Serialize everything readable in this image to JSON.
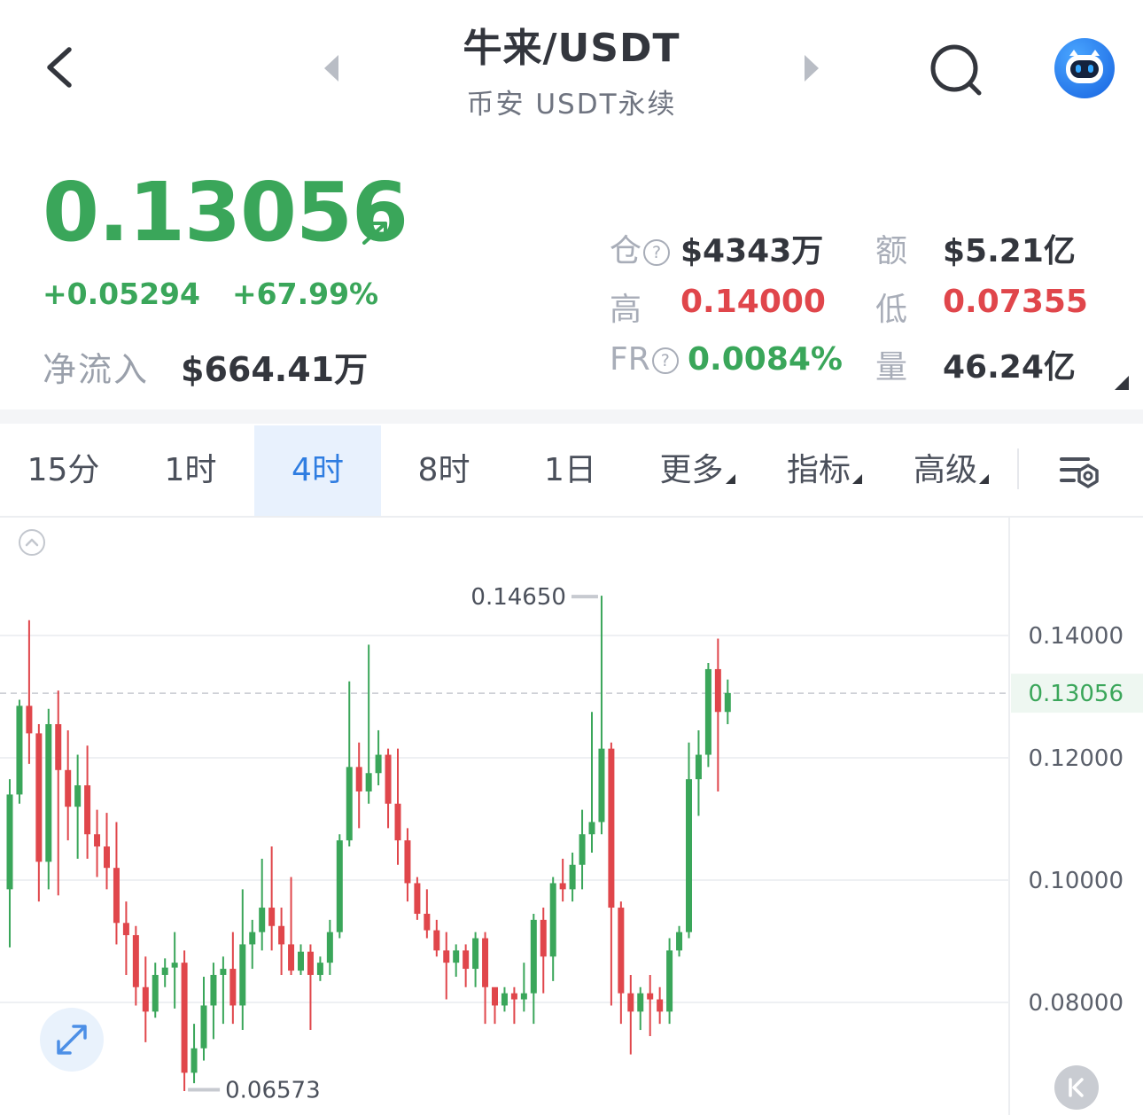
{
  "header": {
    "title": "牛来/USDT",
    "subtitle": "币安 USDT永续"
  },
  "price": {
    "last": "0.13056",
    "change": "+0.05294",
    "change_pct": "+67.99%",
    "inflow_label": "净流入",
    "inflow_value": "$664.41万"
  },
  "stats": {
    "oi_label": "仓",
    "oi_value": "$4343万",
    "turnover_label": "额",
    "turnover_value": "$5.21亿",
    "high_label": "高",
    "high_value": "0.14000",
    "low_label": "低",
    "low_value": "0.07355",
    "fr_label": "FR",
    "fr_value": "0.0084%",
    "volume_label": "量",
    "volume_value": "46.24亿",
    "help_glyph": "?"
  },
  "tabs": [
    {
      "label": "15分",
      "active": false
    },
    {
      "label": "1时",
      "active": false
    },
    {
      "label": "4时",
      "active": true
    },
    {
      "label": "8时",
      "active": false
    },
    {
      "label": "1日",
      "active": false
    },
    {
      "label": "更多",
      "active": false
    },
    {
      "label": "指标",
      "active": false
    },
    {
      "label": "高级",
      "active": false
    }
  ],
  "colors": {
    "up": "#3aa65a",
    "down": "#e0464b",
    "accent": "#2f7de1"
  },
  "chart_data": {
    "type": "candlestick",
    "y_ticks": [
      "0.14000",
      "0.12000",
      "0.10000",
      "0.08000"
    ],
    "y_tick_values": [
      0.14,
      0.12,
      0.1,
      0.08
    ],
    "last_price_label": "0.13056",
    "last_price": 0.13056,
    "max_label": "0.14650",
    "max_value": 0.1465,
    "min_label": "0.06573",
    "min_value": 0.06573,
    "ylim": [
      0.062,
      0.15
    ],
    "candles": [
      [
        0.0985,
        0.114,
        0.089,
        0.1165
      ],
      [
        0.114,
        0.1285,
        0.1125,
        0.1295
      ],
      [
        0.1285,
        0.124,
        0.119,
        0.1425
      ],
      [
        0.124,
        0.103,
        0.0965,
        0.1255
      ],
      [
        0.103,
        0.1255,
        0.0985,
        0.128
      ],
      [
        0.1255,
        0.118,
        0.0975,
        0.131
      ],
      [
        0.118,
        0.112,
        0.1065,
        0.1245
      ],
      [
        0.112,
        0.1155,
        0.1035,
        0.1205
      ],
      [
        0.1155,
        0.1075,
        0.1035,
        0.122
      ],
      [
        0.1075,
        0.1055,
        0.1005,
        0.1115
      ],
      [
        0.1055,
        0.102,
        0.0985,
        0.111
      ],
      [
        0.102,
        0.093,
        0.0895,
        0.1095
      ],
      [
        0.093,
        0.091,
        0.0845,
        0.0965
      ],
      [
        0.091,
        0.0825,
        0.0795,
        0.0925
      ],
      [
        0.0825,
        0.0785,
        0.0735,
        0.0875
      ],
      [
        0.0785,
        0.0845,
        0.0775,
        0.0865
      ],
      [
        0.0845,
        0.0857,
        0.0825,
        0.0872
      ],
      [
        0.0857,
        0.0865,
        0.079,
        0.0915
      ],
      [
        0.0865,
        0.0685,
        0.0655,
        0.0885
      ],
      [
        0.0685,
        0.0725,
        0.0668,
        0.0765
      ],
      [
        0.0725,
        0.0795,
        0.0705,
        0.0842
      ],
      [
        0.0795,
        0.0845,
        0.074,
        0.0865
      ],
      [
        0.0845,
        0.0855,
        0.0765,
        0.0875
      ],
      [
        0.0855,
        0.0795,
        0.0765,
        0.0915
      ],
      [
        0.0795,
        0.0895,
        0.0755,
        0.0985
      ],
      [
        0.0895,
        0.0915,
        0.0855,
        0.0935
      ],
      [
        0.0915,
        0.0955,
        0.0885,
        0.1035
      ],
      [
        0.0955,
        0.0925,
        0.0885,
        0.1055
      ],
      [
        0.0925,
        0.0895,
        0.0845,
        0.0955
      ],
      [
        0.0895,
        0.0852,
        0.0845,
        0.1005
      ],
      [
        0.0852,
        0.0883,
        0.0845,
        0.0895
      ],
      [
        0.0883,
        0.0845,
        0.0755,
        0.0895
      ],
      [
        0.0845,
        0.0865,
        0.0835,
        0.0875
      ],
      [
        0.0865,
        0.0915,
        0.0845,
        0.0935
      ],
      [
        0.0915,
        0.1065,
        0.0905,
        0.1075
      ],
      [
        0.1065,
        0.1185,
        0.1055,
        0.1325
      ],
      [
        0.1185,
        0.1145,
        0.1085,
        0.1225
      ],
      [
        0.1145,
        0.1175,
        0.1125,
        0.1385
      ],
      [
        0.1175,
        0.1205,
        0.1155,
        0.1245
      ],
      [
        0.1205,
        0.1125,
        0.1085,
        0.1215
      ],
      [
        0.1125,
        0.1065,
        0.1025,
        0.1215
      ],
      [
        0.1065,
        0.0995,
        0.0965,
        0.1085
      ],
      [
        0.0995,
        0.0945,
        0.0935,
        0.1005
      ],
      [
        0.0945,
        0.0918,
        0.0905,
        0.0985
      ],
      [
        0.0918,
        0.0885,
        0.0875,
        0.0935
      ],
      [
        0.0885,
        0.0865,
        0.0805,
        0.0915
      ],
      [
        0.0865,
        0.0885,
        0.0842,
        0.0895
      ],
      [
        0.0885,
        0.0855,
        0.0825,
        0.0895
      ],
      [
        0.0855,
        0.0905,
        0.0825,
        0.0915
      ],
      [
        0.0905,
        0.0825,
        0.0765,
        0.0915
      ],
      [
        0.0825,
        0.0795,
        0.0765,
        0.0815
      ],
      [
        0.0795,
        0.0815,
        0.0785,
        0.0825
      ],
      [
        0.0815,
        0.0805,
        0.0765,
        0.0825
      ],
      [
        0.0805,
        0.0815,
        0.0785,
        0.0865
      ],
      [
        0.0815,
        0.0935,
        0.0765,
        0.0945
      ],
      [
        0.0935,
        0.0875,
        0.0815,
        0.0955
      ],
      [
        0.0875,
        0.0995,
        0.0835,
        0.1005
      ],
      [
        0.0995,
        0.0985,
        0.0965,
        0.1035
      ],
      [
        0.0985,
        0.1025,
        0.0965,
        0.1045
      ],
      [
        0.1025,
        0.1075,
        0.0985,
        0.1115
      ],
      [
        0.1075,
        0.1095,
        0.1045,
        0.1275
      ],
      [
        0.1095,
        0.1215,
        0.1075,
        0.1465
      ],
      [
        0.1215,
        0.0955,
        0.0795,
        0.1225
      ],
      [
        0.0955,
        0.0815,
        0.0765,
        0.0965
      ],
      [
        0.0815,
        0.0785,
        0.0715,
        0.0845
      ],
      [
        0.0785,
        0.0815,
        0.0755,
        0.0825
      ],
      [
        0.0815,
        0.0805,
        0.0745,
        0.0845
      ],
      [
        0.0805,
        0.0785,
        0.0765,
        0.0825
      ],
      [
        0.0785,
        0.0885,
        0.0765,
        0.0905
      ],
      [
        0.0885,
        0.0915,
        0.0875,
        0.0925
      ],
      [
        0.0915,
        0.1165,
        0.0905,
        0.1225
      ],
      [
        0.1165,
        0.1205,
        0.1105,
        0.1245
      ],
      [
        0.1205,
        0.1345,
        0.1185,
        0.1355
      ],
      [
        0.1345,
        0.1275,
        0.1145,
        0.1395
      ],
      [
        0.1275,
        0.1306,
        0.1255,
        0.1328
      ]
    ]
  }
}
